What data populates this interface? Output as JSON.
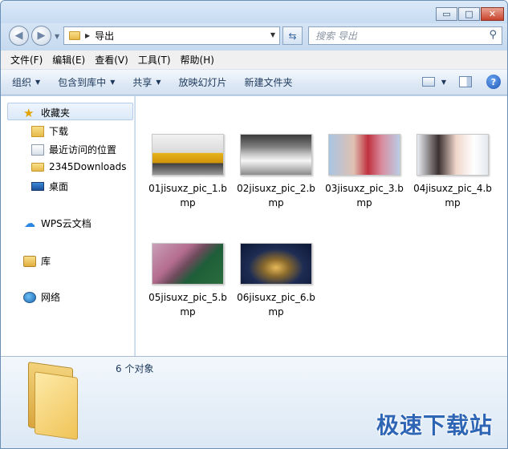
{
  "window": {
    "minimize_glyph": "▭",
    "maximize_glyph": "□",
    "close_glyph": "✕"
  },
  "nav": {
    "back_icon": "arrow-left-icon",
    "forward_icon": "arrow-right-icon",
    "address_path": "导出",
    "search_placeholder": "搜索 导出"
  },
  "menu": {
    "items": [
      "文件(F)",
      "编辑(E)",
      "查看(V)",
      "工具(T)",
      "帮助(H)"
    ]
  },
  "toolbar": {
    "items": [
      "组织",
      "包含到库中",
      "共享",
      "放映幻灯片",
      "新建文件夹"
    ]
  },
  "sidebar": {
    "favorites": "收藏夹",
    "fav_items": [
      "下载",
      "最近访问的位置",
      "2345Downloads",
      "桌面"
    ],
    "wps": "WPS云文档",
    "library": "库",
    "network": "网络"
  },
  "files": [
    {
      "name": "01jisuxz_pic_1.bmp"
    },
    {
      "name": "02jisuxz_pic_2.bmp"
    },
    {
      "name": "03jisuxz_pic_3.bmp"
    },
    {
      "name": "04jisuxz_pic_4.bmp"
    },
    {
      "name": "05jisuxz_pic_5.bmp"
    },
    {
      "name": "06jisuxz_pic_6.bmp"
    }
  ],
  "details": {
    "count_text": "6 个对象"
  },
  "watermark": "极速下载站",
  "colors": {
    "accent": "#2e66b5",
    "window_frame": "#c3d9ef"
  }
}
